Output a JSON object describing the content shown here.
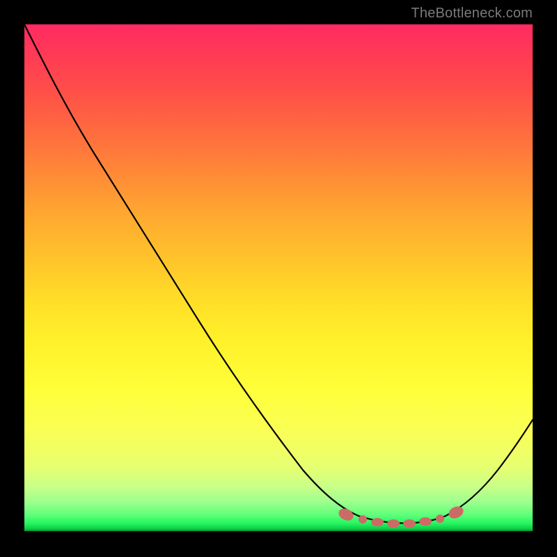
{
  "watermark": "TheBottleneck.com",
  "colors": {
    "background": "#000000",
    "gradient_top": "#ff2a62",
    "gradient_mid": "#fff22a",
    "gradient_bottom": "#26f55e",
    "curve": "#000000",
    "markers": "#cc6b66"
  },
  "chart_data": {
    "type": "line",
    "title": "",
    "xlabel": "",
    "ylabel": "",
    "xlim": [
      0,
      100
    ],
    "ylim": [
      0,
      100
    ],
    "x": [
      0,
      5,
      10,
      15,
      20,
      25,
      30,
      35,
      40,
      45,
      50,
      55,
      60,
      63,
      66,
      69,
      72,
      75,
      78,
      81,
      84,
      88,
      92,
      96,
      100
    ],
    "y": [
      100,
      92,
      84,
      76,
      67,
      59,
      50,
      42,
      34,
      26,
      19,
      12,
      7,
      5,
      3.5,
      2.5,
      2,
      1.8,
      2,
      2.7,
      4.2,
      7,
      11,
      16,
      22
    ],
    "markers_x": [
      63,
      67,
      70,
      73,
      76,
      79,
      82,
      85
    ],
    "markers_y": [
      3.7,
      2.6,
      2.2,
      1.9,
      1.9,
      2.2,
      3.0,
      4.4
    ],
    "notes": "Single black curve descending steeply from upper-left, reaching a flat minimum around x≈73–78, then rising toward the right edge. Reddish circular/oblong markers sit along the curve near its minimum. Background is a vertical heat gradient (red→orange→yellow→green)."
  }
}
